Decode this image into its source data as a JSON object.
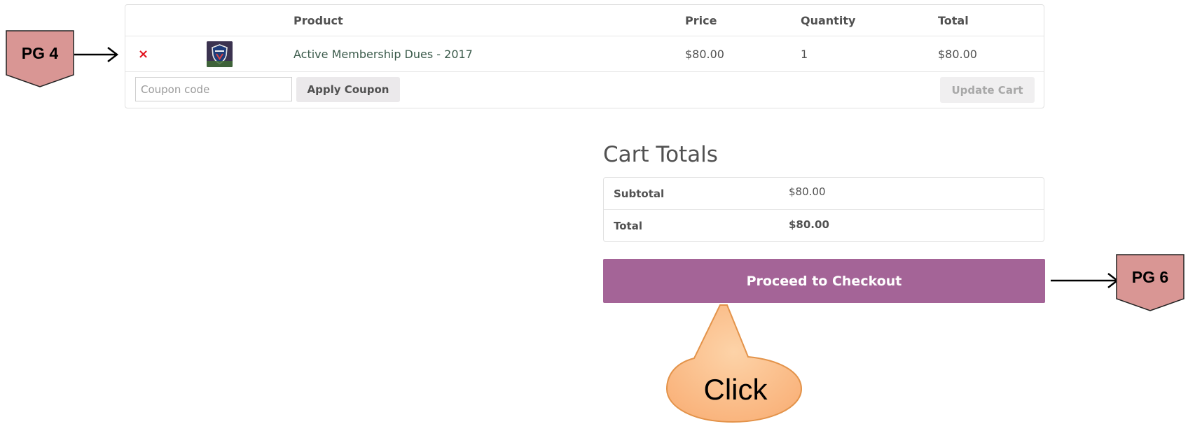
{
  "cart": {
    "headers": {
      "remove": "",
      "thumbnail": "",
      "product": "Product",
      "price": "Price",
      "quantity": "Quantity",
      "total": "Total"
    },
    "items": [
      {
        "remove_icon": "×",
        "product": "Active Membership Dues - 2017",
        "price": "$80.00",
        "quantity": "1",
        "total": "$80.00"
      }
    ],
    "coupon": {
      "placeholder": "Coupon code",
      "value": "",
      "apply_label": "Apply Coupon"
    },
    "update_label": "Update Cart"
  },
  "cart_totals": {
    "title": "Cart Totals",
    "rows": [
      {
        "label": "Subtotal",
        "value": "$80.00"
      },
      {
        "label": "Total",
        "value": "$80.00"
      }
    ],
    "checkout_label": "Proceed to Checkout"
  },
  "annotations": {
    "tag_left": "PG 4",
    "tag_right": "PG 6",
    "callout": "Click"
  },
  "colors": {
    "checkout_button": "#a46497",
    "remove_icon": "#e2131e",
    "tag_fill": "#d99694",
    "callout_fill": "#fbc38f"
  }
}
